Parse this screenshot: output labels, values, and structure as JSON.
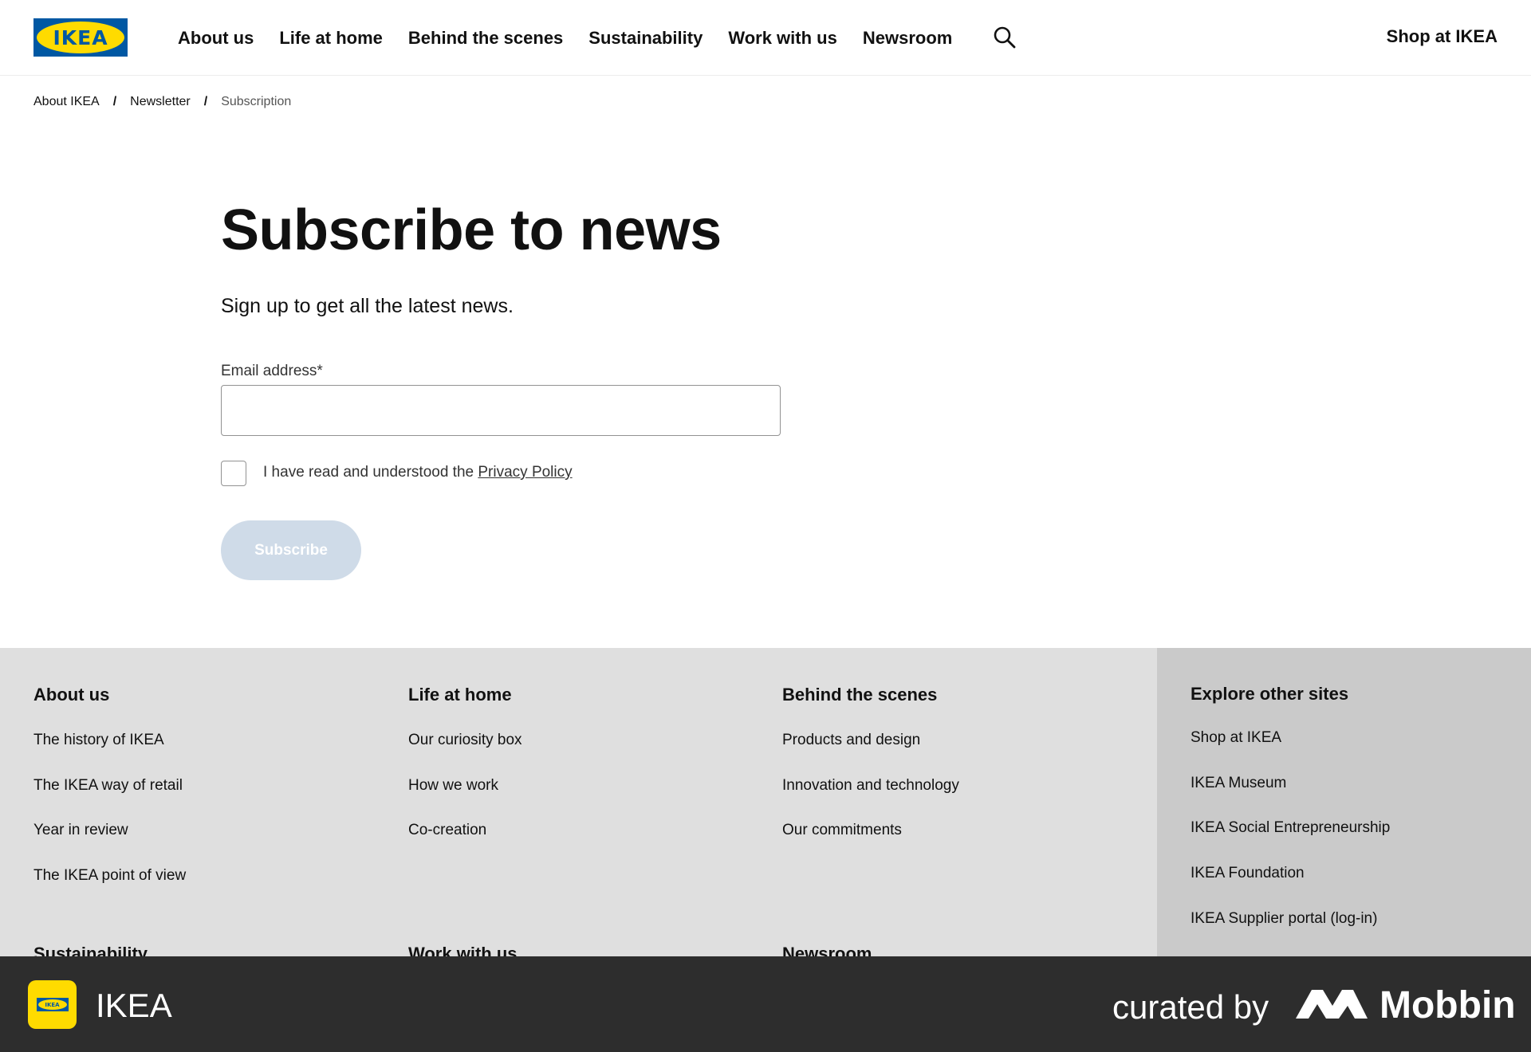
{
  "header": {
    "logo_text": "IKEA",
    "nav": [
      "About us",
      "Life at home",
      "Behind the scenes",
      "Sustainability",
      "Work with us",
      "Newsroom"
    ],
    "search_icon": "search-icon",
    "shop_link": "Shop at IKEA"
  },
  "breadcrumb": {
    "items": [
      "About IKEA",
      "Newsletter",
      "Subscription"
    ],
    "separator": "/"
  },
  "main": {
    "title": "Subscribe to news",
    "lead": "Sign up to get all the latest news.",
    "email_label": "Email address*",
    "email_value": "",
    "checkbox_text": "I have read and understood the ",
    "policy_link": "Privacy Policy",
    "checkbox_checked": false,
    "subscribe_label": "Subscribe"
  },
  "footer": {
    "columns": [
      {
        "heading": "About us",
        "links": [
          "The history of IKEA",
          "The IKEA way of retail",
          "Year in review",
          "The IKEA point of view"
        ]
      },
      {
        "heading": "Life at home",
        "links": [
          "Our curiosity box",
          "How we work",
          "Co-creation"
        ]
      },
      {
        "heading": "Behind the scenes",
        "links": [
          "Products and design",
          "Innovation and technology",
          "Our commitments"
        ]
      }
    ],
    "second_row": [
      "Sustainability",
      "Work with us",
      "Newsroom"
    ],
    "explore": {
      "heading": "Explore other sites",
      "links": [
        "Shop at IKEA",
        "IKEA Museum",
        "IKEA Social Entrepreneurship",
        "IKEA Foundation",
        "IKEA Supplier portal (log-in)"
      ]
    }
  },
  "brandbar": {
    "app_name": "IKEA",
    "app_icon_text": "IKEA",
    "curated_by": "curated by",
    "mobbin": "Mobbin"
  },
  "colors": {
    "ikea_blue": "#0058a3",
    "ikea_yellow": "#ffdb00",
    "button_disabled": "#cfdbe8",
    "footer_bg": "#dfdfdf",
    "footer_side_bg": "#cacaca",
    "brandbar_bg": "#2d2d2d"
  }
}
